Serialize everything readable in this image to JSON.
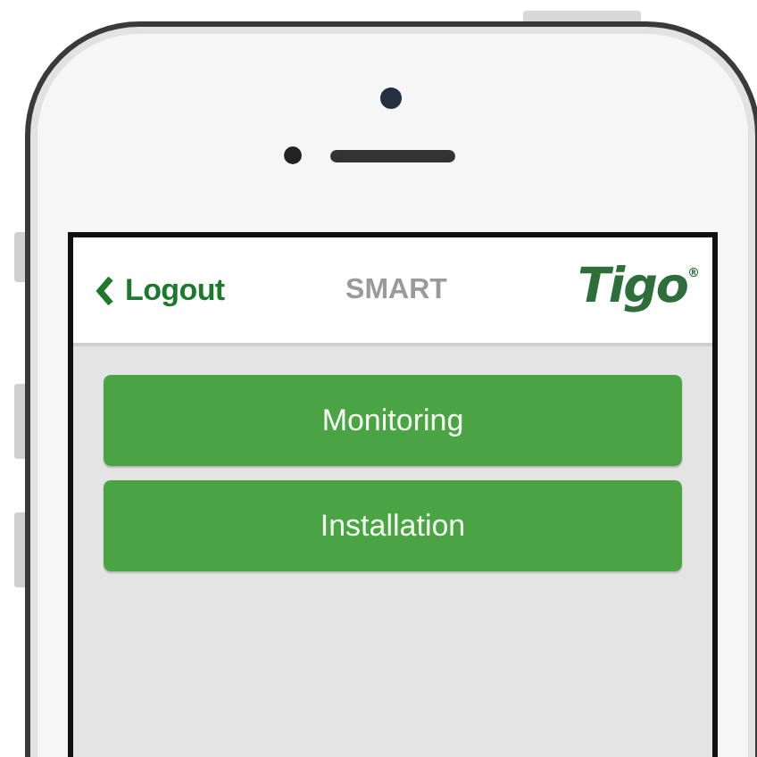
{
  "header": {
    "back_button": "Logout",
    "title": "SMART",
    "logo": {
      "name": "Tigo",
      "mark": "®"
    }
  },
  "menu": [
    {
      "label": "Monitoring"
    },
    {
      "label": "Installation"
    }
  ]
}
